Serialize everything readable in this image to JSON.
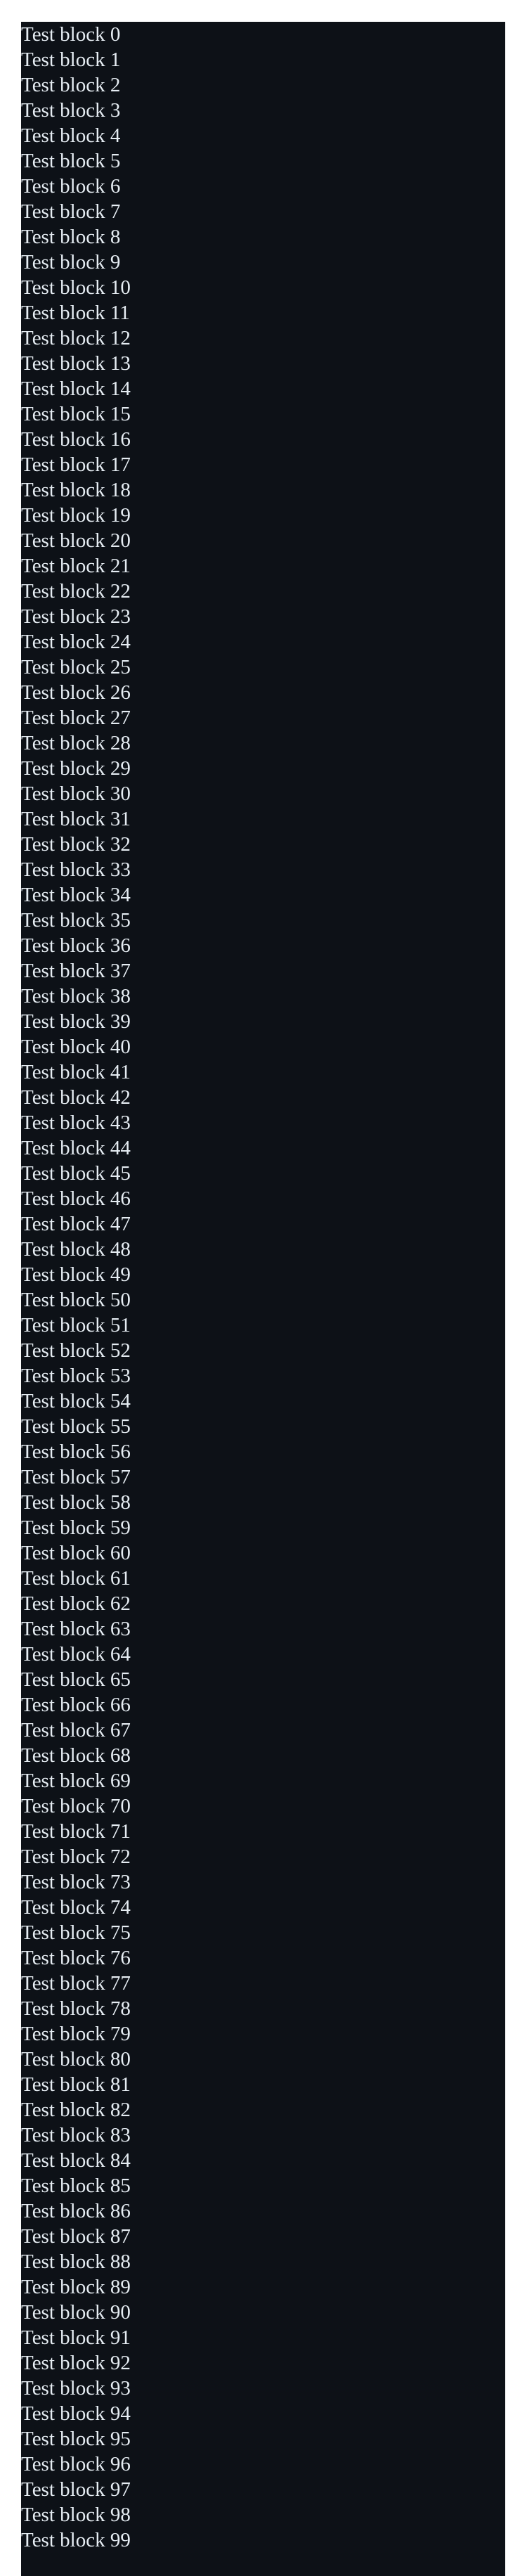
{
  "panel": {
    "background": "#0d1117",
    "text_color": "#e6edf3",
    "blocks": [
      "Test block 0",
      "Test block 1",
      "Test block 2",
      "Test block 3",
      "Test block 4",
      "Test block 5",
      "Test block 6",
      "Test block 7",
      "Test block 8",
      "Test block 9",
      "Test block 10",
      "Test block 11",
      "Test block 12",
      "Test block 13",
      "Test block 14",
      "Test block 15",
      "Test block 16",
      "Test block 17",
      "Test block 18",
      "Test block 19",
      "Test block 20",
      "Test block 21",
      "Test block 22",
      "Test block 23",
      "Test block 24",
      "Test block 25",
      "Test block 26",
      "Test block 27",
      "Test block 28",
      "Test block 29",
      "Test block 30",
      "Test block 31",
      "Test block 32",
      "Test block 33",
      "Test block 34",
      "Test block 35",
      "Test block 36",
      "Test block 37",
      "Test block 38",
      "Test block 39",
      "Test block 40",
      "Test block 41",
      "Test block 42",
      "Test block 43",
      "Test block 44",
      "Test block 45",
      "Test block 46",
      "Test block 47",
      "Test block 48",
      "Test block 49",
      "Test block 50",
      "Test block 51",
      "Test block 52",
      "Test block 53",
      "Test block 54",
      "Test block 55",
      "Test block 56",
      "Test block 57",
      "Test block 58",
      "Test block 59",
      "Test block 60",
      "Test block 61",
      "Test block 62",
      "Test block 63",
      "Test block 64",
      "Test block 65",
      "Test block 66",
      "Test block 67",
      "Test block 68",
      "Test block 69",
      "Test block 70",
      "Test block 71",
      "Test block 72",
      "Test block 73",
      "Test block 74",
      "Test block 75",
      "Test block 76",
      "Test block 77",
      "Test block 78",
      "Test block 79",
      "Test block 80",
      "Test block 81",
      "Test block 82",
      "Test block 83",
      "Test block 84",
      "Test block 85",
      "Test block 86",
      "Test block 87",
      "Test block 88",
      "Test block 89",
      "Test block 90",
      "Test block 91",
      "Test block 92",
      "Test block 93",
      "Test block 94",
      "Test block 95",
      "Test block 96",
      "Test block 97",
      "Test block 98",
      "Test block 99"
    ]
  }
}
